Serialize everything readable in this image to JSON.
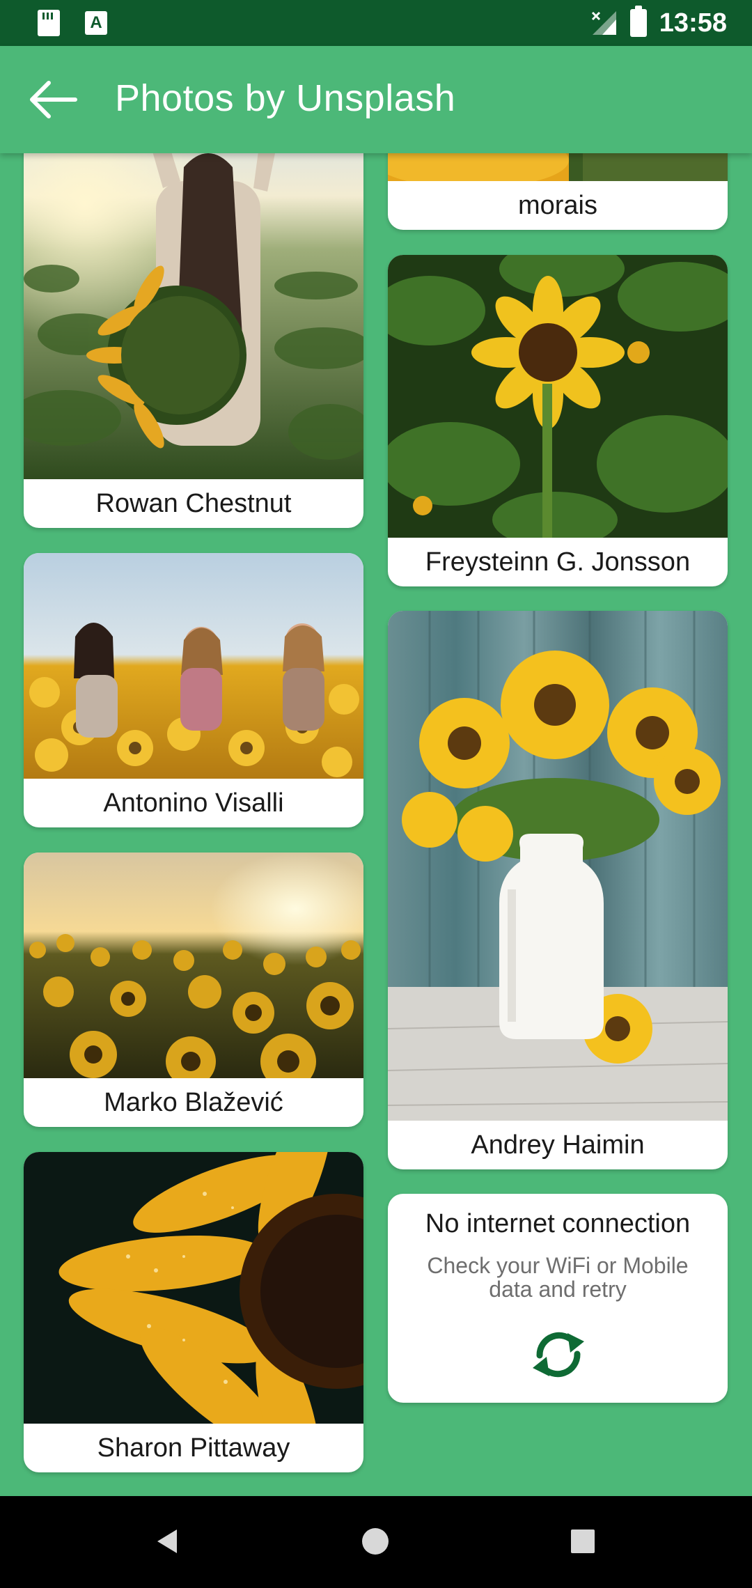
{
  "status_bar": {
    "time": "13:58",
    "left_icons": [
      "sd-card-icon",
      "a-icon"
    ],
    "right_icons": [
      "no-signal-icon",
      "battery-icon"
    ],
    "a_glyph": "A"
  },
  "app_bar": {
    "title": "Photos by Unsplash",
    "back_icon": "arrow-left-icon"
  },
  "photos": {
    "left": [
      {
        "author": "Rowan Chestnut",
        "subject": "woman-in-sunflower-field"
      },
      {
        "author": "Antonino Visalli",
        "subject": "friends-in-sunflower-field"
      },
      {
        "author": "Marko Blažević",
        "subject": "sunflower-field-at-sunset"
      },
      {
        "author": "Sharon Pittaway",
        "subject": "sunflower-closeup-with-dew"
      }
    ],
    "right": [
      {
        "author": "morais",
        "subject": "sunflowers-cropped"
      },
      {
        "author": "Freysteinn G. Jonsson",
        "subject": "single-sunflower-among-leaves"
      },
      {
        "author": "Andrey Haimin",
        "subject": "sunflowers-in-white-vase"
      }
    ]
  },
  "no_internet": {
    "title": "No internet connection",
    "message": "Check your WiFi or Mobile data and retry",
    "retry_icon": "refresh-icon"
  },
  "colors": {
    "primary": "#4cb878",
    "status_bar": "#0e5a2c",
    "card": "#ffffff",
    "retry_icon": "#0e6a34"
  },
  "nav_bar": {
    "buttons": [
      "back-triangle-icon",
      "home-circle-icon",
      "recents-square-icon"
    ]
  }
}
